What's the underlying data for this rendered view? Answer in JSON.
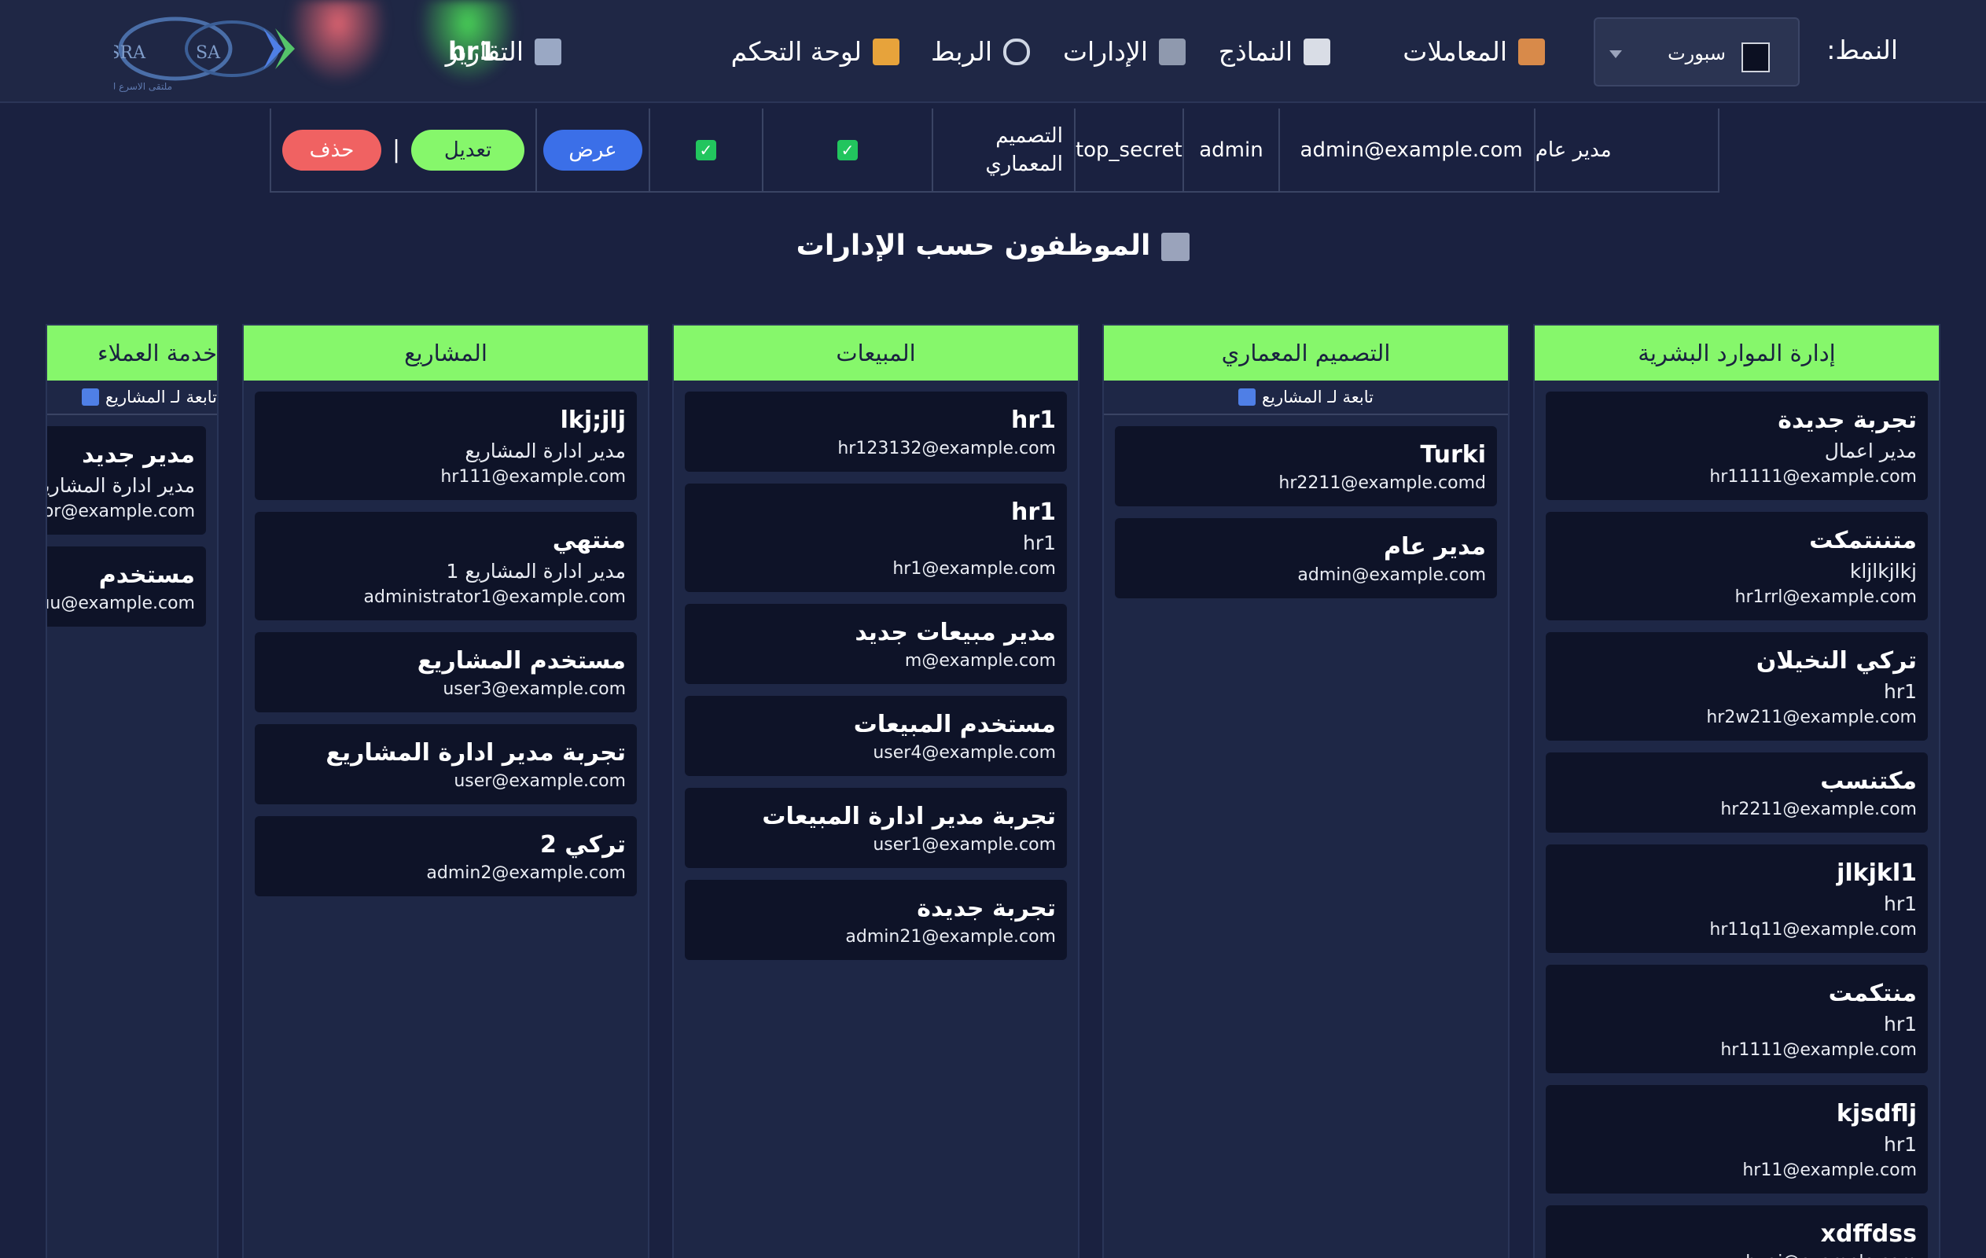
{
  "header": {
    "mode_label": "النمط:",
    "mode_select_value": "سبورت",
    "username": "hr1",
    "nav": [
      {
        "label": "المعاملات",
        "icon": "clipboard-icon"
      },
      {
        "label": "النماذج",
        "icon": "document-icon"
      },
      {
        "label": "الإدارات",
        "icon": "building-icon"
      },
      {
        "label": "الربط",
        "icon": "link-icon"
      },
      {
        "label": "لوحة التحكم",
        "icon": "home-icon"
      },
      {
        "label": "التقارير",
        "icon": "chart-icon"
      }
    ],
    "logo": {
      "left_text": "ASRA",
      "right_text": "SA",
      "tagline": "ملتقى الاسرع لتقنية المعلومات"
    }
  },
  "user_row": {
    "name": "مدير عام",
    "email": "admin@example.com",
    "role": "admin",
    "clearance": "top_secret",
    "department": "التصميم المعماري",
    "view_label": "عرض",
    "edit_label": "تعديل",
    "delete_label": "حذف",
    "separator": "|"
  },
  "section_title": "الموظفون حسب الإدارات",
  "columns": [
    {
      "title": "إدارة الموارد البشرية",
      "cards": [
        {
          "name": "تجربة جديدة",
          "role": "مدير اعمال",
          "email": "hr11111@example.com"
        },
        {
          "name": "متننتمكت",
          "role": "kljlkjlkj",
          "email": "hr1rrl@example.com"
        },
        {
          "name": "تركي النخيلان",
          "role": "hr1",
          "email": "hr2w211@example.com"
        },
        {
          "name": "مكتنسب",
          "role": "",
          "email": "hr2211@example.com"
        },
        {
          "name": "jlkjkl1",
          "role": "hr1",
          "email": "hr11q11@example.com"
        },
        {
          "name": "منتكمت",
          "role": "hr1",
          "email": "hr1111@example.com"
        },
        {
          "name": "kjsdflj",
          "role": "hr1",
          "email": "hr11@example.com"
        },
        {
          "name": "xdffdss",
          "role": "",
          "email": "hygj@example.com"
        }
      ]
    },
    {
      "title": "التصميم المعماري",
      "subtitle": "تابعة لـ المشاريع",
      "cards": [
        {
          "name": "Turki",
          "role": "",
          "email": "hr2211@example.comd"
        },
        {
          "name": "مدير عام",
          "role": "",
          "email": "admin@example.com"
        }
      ]
    },
    {
      "title": "المبيعات",
      "cards": [
        {
          "name": "hr1",
          "role": "",
          "email": "hr123132@example.com"
        },
        {
          "name": "hr1",
          "role": "hr1",
          "email": "hr1@example.com"
        },
        {
          "name": "مدير مبيعات جديد",
          "role": "",
          "email": "m@example.com"
        },
        {
          "name": "مستخدم المبيعات",
          "role": "",
          "email": "user4@example.com"
        },
        {
          "name": "تجربة مدير ادارة المبيعات",
          "role": "",
          "email": "user1@example.com"
        },
        {
          "name": "تجربة جديدة",
          "role": "",
          "email": "admin21@example.com"
        }
      ]
    },
    {
      "title": "المشاريع",
      "cards": [
        {
          "name": "lkj;jlj",
          "role": "مدير ادارة المشاريع",
          "email": "hr111@example.com"
        },
        {
          "name": "منتهي",
          "role": "مدير ادارة المشاريع 1",
          "email": "administrator1@example.com"
        },
        {
          "name": "مستخدم المشاريع",
          "role": "",
          "email": "user3@example.com"
        },
        {
          "name": "تجربة مدير ادارة المشاريع",
          "role": "",
          "email": "user@example.com"
        },
        {
          "name": "تركي 2",
          "role": "",
          "email": "admin2@example.com"
        }
      ]
    },
    {
      "title": "خدمة العملاء",
      "subtitle": "تابعة لـ المشاريع",
      "cards": [
        {
          "name": "مدير جديد",
          "role": "مدير ادارة المشاريع",
          "email": "administrator@example.com"
        },
        {
          "name": "مستخدم",
          "role": "",
          "email": "uuuu@example.com"
        }
      ]
    }
  ],
  "colors": {
    "accent_green": "#86f76b",
    "view_blue": "#3b6fe8",
    "delete_red": "#f06262",
    "bg": "#1a2140",
    "card_bg": "#0e1328"
  }
}
